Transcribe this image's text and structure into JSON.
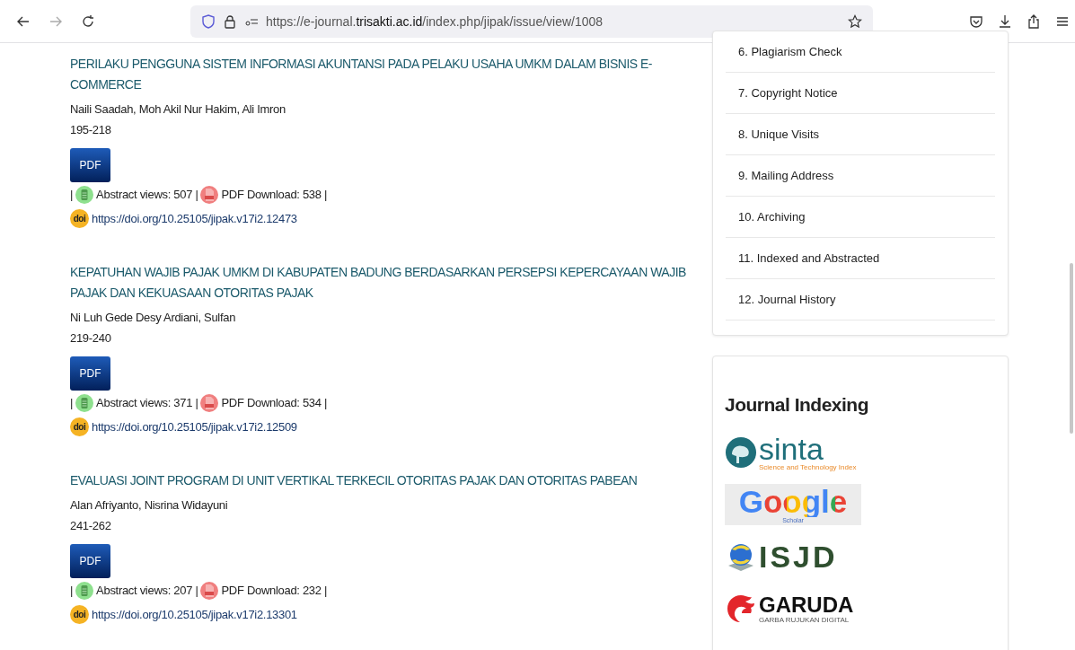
{
  "browser": {
    "url_prefix": "https://e-journal.",
    "url_domain": "trisakti.ac.id",
    "url_path": "/index.php/jipak/issue/view/1008"
  },
  "articles": [
    {
      "title": "PERILAKU PENGGUNA SISTEM INFORMASI AKUNTANSI PADA PELAKU USAHA UMKM DALAM BISNIS E-COMMERCE",
      "authors": "Naili Saadah, Moh Akil Nur Hakim, Ali Imron",
      "pages": "195-218",
      "galley": "PDF",
      "lead": "|",
      "abstract_views": "Abstract views: 507 |",
      "pdf_downloads": "PDF Download: 538 |",
      "doi_badge": "doi",
      "doi": "https://doi.org/10.25105/jipak.v17i2.12473"
    },
    {
      "title": "KEPATUHAN WAJIB PAJAK UMKM DI KABUPATEN BADUNG BERDASARKAN PERSEPSI KEPERCAYAAN WAJIB PAJAK DAN KEKUASAAN OTORITAS PAJAK",
      "authors": "Ni Luh Gede Desy Ardiani, Sulfan",
      "pages": "219-240",
      "galley": "PDF",
      "lead": "|",
      "abstract_views": "Abstract views: 371 |",
      "pdf_downloads": "PDF Download: 534 |",
      "doi_badge": "doi",
      "doi": "https://doi.org/10.25105/jipak.v17i2.12509"
    },
    {
      "title": "EVALUASI JOINT PROGRAM DI UNIT VERTIKAL TERKECIL OTORITAS PAJAK DAN OTORITAS PABEAN",
      "authors": "Alan Afriyanto, Nisrina Widayuni",
      "pages": "241-262",
      "galley": "PDF",
      "lead": "|",
      "abstract_views": "Abstract views: 207 |",
      "pdf_downloads": "PDF Download: 232 |",
      "doi_badge": "doi",
      "doi": "https://doi.org/10.25105/jipak.v17i2.13301"
    }
  ],
  "sidebar": {
    "menu": [
      "6. Plagiarism Check",
      "7. Copyright Notice",
      "8. Unique Visits",
      "9. Mailing Address",
      "10. Archiving",
      "11. Indexed and Abstracted",
      "12. Journal History"
    ],
    "indexing": {
      "title": "Journal Indexing",
      "logos": [
        {
          "kind": "sinta",
          "name": "sinta",
          "tagline": "Science and Technology Index"
        },
        {
          "kind": "google",
          "name": "Google",
          "tagline": "Scholar"
        },
        {
          "kind": "isjd",
          "name": "ISJD"
        },
        {
          "kind": "garuda",
          "name": "GARUDA",
          "tagline": "GARBA RUJUKAN DIGITAL"
        }
      ]
    }
  }
}
